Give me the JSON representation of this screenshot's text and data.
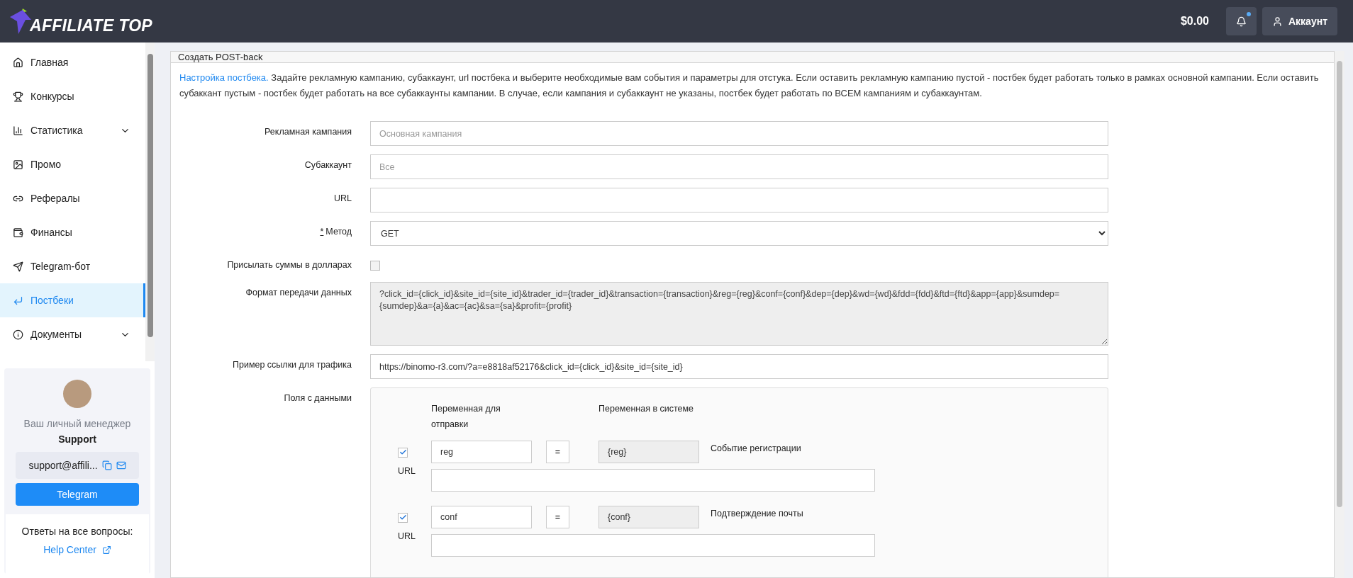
{
  "header": {
    "logo": "AFFILIATE TOP",
    "balance": "$0.00",
    "notifications_unread": true,
    "account": "Аккаунт"
  },
  "sidebar": {
    "items": [
      {
        "label": "Главная",
        "expandable": false,
        "selected": false
      },
      {
        "label": "Конкурсы",
        "expandable": false,
        "selected": false
      },
      {
        "label": "Статистика",
        "expandable": true,
        "selected": false
      },
      {
        "label": "Промо",
        "expandable": false,
        "selected": false
      },
      {
        "label": "Рефералы",
        "expandable": false,
        "selected": false
      },
      {
        "label": "Финансы",
        "expandable": false,
        "selected": false
      },
      {
        "label": "Telegram-бот",
        "expandable": false,
        "selected": false
      },
      {
        "label": "Постбеки",
        "expandable": false,
        "selected": true
      },
      {
        "label": "Документы",
        "expandable": true,
        "selected": false
      }
    ],
    "manager": {
      "caption": "Ваш личный менеджер",
      "name": "Support",
      "email": "support@affili...",
      "button": "Telegram",
      "help_text": "Ответы на все вопросы:",
      "help_link": "Help Center"
    }
  },
  "card": {
    "title": "Создать POST-back",
    "intro_link": "Настройка постбека.",
    "intro_text": "Задайте рекламную кампанию, субаккаунт, url постбека и выберите необходимые вам события и параметры для отстука. Если оставить рекламную кампанию пустой - постбек будет работать только в рамках основной кампании. Если оставить субаккант пустым - постбек будет работать на все субаккаунты кампании. В случае, если кампания и субаккаунт не указаны, постбек будет работать по ВСЕМ кампаниям и субаккаунтам.",
    "fields": [
      {
        "kind": "input",
        "label": "Рекламная кампания",
        "placeholder": "Основная кампания"
      },
      {
        "kind": "input",
        "label": "Субаккаунт",
        "placeholder": "Все"
      },
      {
        "kind": "input",
        "label": "URL"
      },
      {
        "kind": "select",
        "label": "Метод",
        "required_mark": "*",
        "value": "GET"
      },
      {
        "kind": "checkbox",
        "label": "Присылать суммы в долларах",
        "checked": false
      },
      {
        "kind": "textarea",
        "label": "Формат передачи данных",
        "value": "?click_id={click_id}&site_id={site_id}&trader_id={trader_id}&transaction={transaction}&reg={reg}&conf={conf}&dep={dep}&wd={wd}&fdd={fdd}&ftd={ftd}&app={app}&sumdep={sumdep}&a={a}&ac={ac}&sa={sa}&profit={profit}"
      },
      {
        "kind": "input",
        "label": "Пример ссылки для трафика",
        "value": "https://binomo-r3.com/?a=e8818af52176&click_id={click_id}&site_id={site_id}"
      }
    ],
    "data_fields": {
      "label": "Поля с данными",
      "column_send": "Переменная для отправки",
      "column_system": "Переменная в системе",
      "rows": [
        {
          "checked": true,
          "send_var": "reg",
          "equals": "=",
          "system_var": "{reg}",
          "event": "Событие регистрации",
          "url_label": "URL"
        },
        {
          "checked": true,
          "send_var": "conf",
          "equals": "=",
          "system_var": "{conf}",
          "event": "Подтверждение почты",
          "url_label": "URL"
        }
      ]
    }
  }
}
